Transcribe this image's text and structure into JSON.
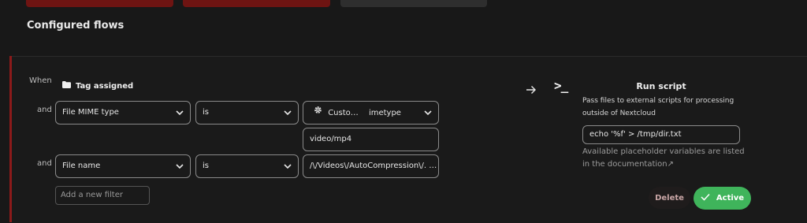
{
  "section": {
    "title": "Configured flows"
  },
  "flow": {
    "when_label": "When",
    "trigger": {
      "icon": "folder-icon",
      "label": "Tag assigned"
    },
    "checks": [
      {
        "and_label": "and",
        "field": "File MIME type",
        "operator": "is",
        "value_icon": "gear-icon",
        "value_prefix": "Custo…",
        "value_suffix": "imetype",
        "custom_value": "video/mp4"
      },
      {
        "and_label": "and",
        "field": "File name",
        "operator": "is",
        "value": "/\\/Videos\\/AutoCompression\\/. …"
      }
    ],
    "add_filter_placeholder": "Add a new filter"
  },
  "operation": {
    "icon": "terminal-icon",
    "icon_text": ">_",
    "title": "Run script",
    "description": "Pass files to external scripts for processing outside of Nextcloud",
    "script_value": "echo '%f' > /tmp/dir.txt",
    "hint": "Available placeholder variables are listed in the documentation↗"
  },
  "actions": {
    "delete_label": "Delete",
    "active_label": "Active"
  },
  "colors": {
    "accent_red": "#8b1a1a",
    "success": "#3fb45b",
    "card_red": "#6e1412"
  }
}
